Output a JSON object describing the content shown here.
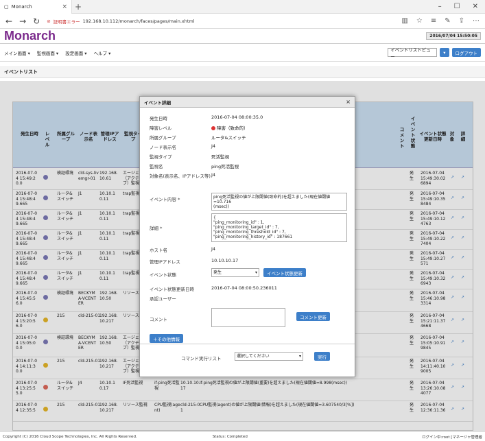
{
  "browser": {
    "tab_title": "Monarch",
    "url_warning": "証明書エラー",
    "url": "192.168.10.112/monarch/faces/pages/main.xhtml"
  },
  "app": {
    "logo": "Monarch",
    "clock": "2016/07/04 15:50:05"
  },
  "menu": {
    "items": [
      "メイン画面 ▾",
      "監視画面 ▾",
      "設定画面 ▾",
      "ヘルプ ▾"
    ],
    "view_select": "イベントリストビュー",
    "logout": "ログアウト"
  },
  "section_title": "イベントリスト",
  "table": {
    "headers": [
      "発生日時",
      "レベル",
      "所属グループ",
      "ノード表示名",
      "管理IPアドレス",
      "監視タイプ",
      "コメント",
      "イベント状態",
      "イベント状態更新日時",
      "対象",
      "詳細"
    ],
    "rows": [
      {
        "date": "2016-07-0\n4 15:49:2\n0.0",
        "level": "info",
        "group": "検証環境",
        "node": "cld-sys-liv\nemgr-01",
        "ip": "192.168.\n10.61",
        "type": "エージェ\n（アクテ\nブ）監視",
        "msg": "",
        "state": "発生",
        "upd": "2016-07-04\n15:49:30.02\n6894"
      },
      {
        "date": "2016-07-0\n4 15:48:4\n9.665",
        "level": "info",
        "group": "ルータ&\nスイッチ",
        "node": "J1",
        "ip": "10.10.1\n0.11",
        "type": "trap監視",
        "msg": "",
        "state": "発生",
        "upd": "2016-07-04\n15:49:10.35\n8484"
      },
      {
        "date": "2016-07-0\n4 15:48:4\n9.665",
        "level": "info",
        "group": "ルータ&\nスイッチ",
        "node": "J1",
        "ip": "10.10.1\n0.11",
        "type": "trap監視",
        "msg": "",
        "state": "発生",
        "upd": "2016-07-04\n15:49:10.12\n4763"
      },
      {
        "date": "2016-07-0\n4 15:48:4\n9.665",
        "level": "info",
        "group": "ルータ&\nスイッチ",
        "node": "J1",
        "ip": "10.10.1\n0.11",
        "type": "trap監視",
        "msg": "",
        "state": "発生",
        "upd": "2016-07-04\n15:49:10.22\n7404"
      },
      {
        "date": "2016-07-0\n4 15:48:4\n9.665",
        "level": "info",
        "group": "ルータ&\nスイッチ",
        "node": "J1",
        "ip": "10.10.1\n0.11",
        "type": "trap監視",
        "msg": "",
        "state": "発生",
        "upd": "2016-07-04\n15:49:10.27\n571"
      },
      {
        "date": "2016-07-0\n4 15:48:4\n9.665",
        "level": "info",
        "group": "ルータ&\nスイッチ",
        "node": "J1",
        "ip": "10.10.1\n0.11",
        "type": "trap監視",
        "msg": "",
        "state": "発生",
        "upd": "2016-07-04\n15:49:10.32\n6943"
      },
      {
        "date": "2016-07-0\n4 15:45:5\n6.0",
        "level": "info",
        "group": "検証環境",
        "node": "BECKYM\nA-VCENT\nER",
        "ip": "192.168.\n10.50",
        "type": "リソース",
        "msg": "",
        "state": "発生",
        "upd": "2016-07-04\n15:46:10.98\n3314"
      },
      {
        "date": "2016-07-0\n4 15:20:5\n6.0",
        "level": "warn",
        "group": "215",
        "node": "cld-215-01",
        "ip": "192.168.\n10.217",
        "type": "リソース",
        "msg": "",
        "state": "発生",
        "upd": "2016-07-04\n15:21:11.37\n4668"
      },
      {
        "date": "2016-07-0\n4 15:05:0\n0.0",
        "level": "info",
        "group": "検証環境",
        "node": "BECKYM\nA-VCENT\nER",
        "ip": "192.168.\n10.50",
        "type": "エージェ\n（アクテ\nブ）監視",
        "msg": "",
        "state": "発生",
        "upd": "2016-07-04\n15:05:10.91\n9845"
      },
      {
        "date": "2016-07-0\n4 14:11:3\n0.0",
        "level": "warn",
        "group": "215",
        "node": "cld-215-01",
        "ip": "192.168.\n10.217",
        "type": "エージェ\n（アクテ\nブ）監視",
        "msg": "",
        "state": "発生",
        "upd": "2016-07-04\n14:11:40.10\n9005"
      },
      {
        "date": "2016-07-0\n4 13:25:5\n5.0",
        "level": "error",
        "group": "ルータ&\nスイッチ",
        "node": "J4",
        "ip": "10.10.1\n0.17",
        "type": "IF死活監視",
        "type2": "if-ping死活監\n視",
        "ip2": "10.10.10.\n17",
        "msg": "If-ping死活監視の値が上限閾値(重要)を超えました(現在値閾値=8.998(msec))",
        "state": "発生",
        "upd": "2016-07-04\n13:26:10.08\n4077"
      },
      {
        "date": "2016-07-0\n4 12:35:5",
        "level": "warn",
        "group": "215",
        "node": "cld-215-01",
        "ip": "192.168.\n10.217",
        "type": "リソース監視",
        "type2": "CPU監視(age\nnt)",
        "ip2": "cld-215-0\n1",
        "msg": "CPU監視(agent)の値が上限閾値(情報)を超えました(現在値閾値=3.607540/3[%])",
        "state": "発生",
        "upd": "2016-07-04\n12:36:11.36"
      }
    ]
  },
  "dialog": {
    "title": "イベント詳細",
    "close": "×",
    "fields": [
      {
        "label": "発生日時",
        "value": "2016-07-04 08:00:35.0"
      },
      {
        "label": "障害レベル",
        "value": "障害（致命的）"
      },
      {
        "label": "所属グループ",
        "value": "ルータ&スイッチ"
      },
      {
        "label": "ノード表示名",
        "value": "J4"
      },
      {
        "label": "監視タイプ",
        "value": "死活監視"
      },
      {
        "label": "監視名",
        "value": "ping死活監視"
      },
      {
        "label": "対象名(表示名、IPアドレス等)",
        "value": "J4"
      }
    ],
    "content_label": "イベント内容 *",
    "content_value": "ping死活監視の値が上限閾値(致命的)を超えました(現在値閾値=10.716\n(msec))",
    "detail_label": "詳細 *",
    "detail_value": "{\n\"ping_monitoring_id\" : 1,\n\"ping_monitoring_target_id\" : 7,\n\"ping_monitoring_threshold_id\" : 7,\n\"ping_monitoring_history_id\" : 187661",
    "host_label": "ホスト名",
    "host_value": "J4",
    "ip_label": "管理IPアドレス",
    "ip_value": "10.10.10.17",
    "state_label": "イベント状態",
    "state_value": "発生",
    "state_button": "イベント状態更新",
    "upd_label": "イベント状態更新日時",
    "upd_value": "2016-07-04 08:00:50.236011",
    "user_label": "承認ユーザー",
    "comment_label": "コメント",
    "comment_button": "コメント更新",
    "other_button": "＋その他情報",
    "cmd_label": "コマンド実行リスト",
    "cmd_select": "選択してください",
    "cmd_button": "実行"
  },
  "footer": {
    "copyright": "Copyright (C) 2016 Cloud Scope Technologies, Inc. All Rights Reserved.",
    "status": "Status: Completed",
    "login": "ログイン中:root [マネージャ管理者"
  }
}
